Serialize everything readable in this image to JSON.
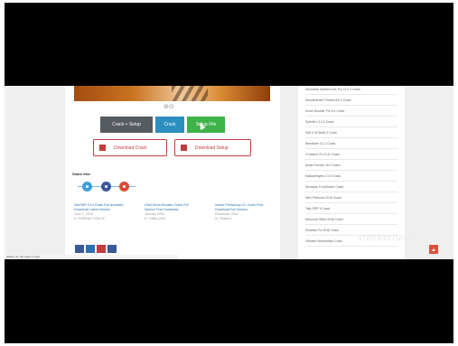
{
  "page": {
    "hero_controls": "⊘⊙",
    "buttons": {
      "crack_setup": "Crack + Setup",
      "crack": "Crack",
      "setup": "Setup File"
    },
    "downloads": {
      "crack": "Download Crack",
      "setup": "Download Setup"
    },
    "share_title": "Share this:",
    "related": [
      {
        "title": "WinRAR 5.10 Crack Full Activated Download Latest Version",
        "date": "June 1, 2018",
        "cat": "In \"WINRAR CRACK\""
      },
      {
        "title": "IObit Driver Booster Crack Full Version Free Download",
        "date": "January 2018",
        "cat": "In \"Utility tools\""
      },
      {
        "title": "Adobe Photoshop CC Crack Free Download Full Version",
        "date": "December 2018",
        "cat": "In \"Graphic\""
      }
    ],
    "status_text": "Waiting for the page to load"
  },
  "sidebar": {
    "items": [
      "Advanced SystemCare Pro 11.0.3 Crack",
      "Wondershare Filmora 8.5.3 Crack",
      "Driver Booster Pro 5.4 Crack",
      "Sylenth1 3.0.3 Crack",
      "IDM 6.30 Build 3 Crack",
      "Bandicam 4.1.2 Crack",
      "CCleaner Pro 5.41 Crack",
      "Avast Premier 18.3 Crack",
      "Malwarebytes 3.4.5 Crack",
      "Windows 10 Activator Crack",
      "Nero Platinum 2018 Crack",
      "Tally ERP 9 Crack",
      "Microsoft Office 2016 Crack",
      "Smadav Pro 2018 Crack",
      "VMware Workstation Crack"
    ]
  },
  "watermark": "videoscribe",
  "colors": {
    "crack_setup_button": "#555b60",
    "crack_button": "#2c8fbf",
    "setup_button": "#3db34a",
    "download_border": "#c23c3c"
  }
}
